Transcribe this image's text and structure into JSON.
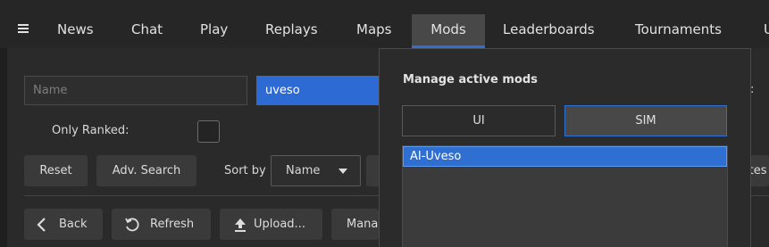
{
  "nav": {
    "tabs": [
      {
        "label": "News"
      },
      {
        "label": "Chat"
      },
      {
        "label": "Play"
      },
      {
        "label": "Replays"
      },
      {
        "label": "Maps"
      },
      {
        "label": "Mods",
        "active": true
      },
      {
        "label": "Leaderboards"
      },
      {
        "label": "Tournaments"
      },
      {
        "label": "U"
      }
    ],
    "menu_icon": "hamburger-icon",
    "accent_color": "#2f6fd1"
  },
  "search": {
    "name_placeholder": "Name",
    "author_value": "uveso",
    "only_ranked_label": "Only Ranked:",
    "only_ranked_checked": false,
    "reset_label": "Reset",
    "adv_search_label": "Adv. Search",
    "sort_by_label": "Sort by",
    "sort_value": "Name",
    "clipped_right_label": ":",
    "clipped_button_label": "ites"
  },
  "actions": {
    "back_label": "Back",
    "refresh_label": "Refresh",
    "upload_label": "Upload...",
    "manage_label": "Mana"
  },
  "popup": {
    "title": "Manage active mods",
    "ui_label": "UI",
    "sim_label": "SIM",
    "active_toggle": "SIM",
    "mods": [
      "AI-Uveso"
    ]
  }
}
